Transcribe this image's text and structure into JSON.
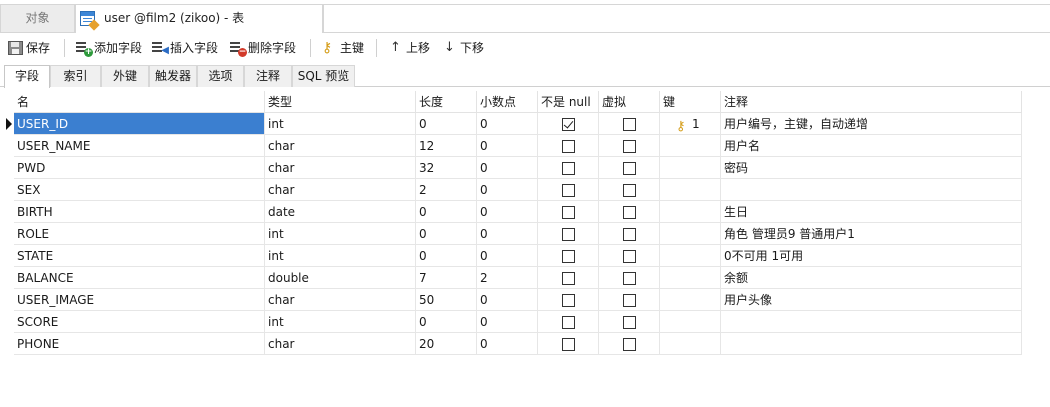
{
  "window_tabs": {
    "objects_label": "对象",
    "active_label": "user @film2 (zikoo) - 表"
  },
  "toolbar": {
    "save": "保存",
    "add_field": "添加字段",
    "insert_field": "插入字段",
    "delete_field": "删除字段",
    "primary_key": "主键",
    "move_up": "上移",
    "move_down": "下移"
  },
  "subtabs": [
    "字段",
    "索引",
    "外键",
    "触发器",
    "选项",
    "注释",
    "SQL 预览"
  ],
  "columns": {
    "name": "名",
    "type": "类型",
    "length": "长度",
    "decimals": "小数点",
    "not_null": "不是 null",
    "virtual": "虚拟",
    "key": "键",
    "comment": "注释"
  },
  "fields": [
    {
      "name": "USER_ID",
      "type": "int",
      "length": "0",
      "decimals": "0",
      "not_null": true,
      "virtual": false,
      "key": "1",
      "comment": "用户编号，主键，自动递增",
      "selected": true
    },
    {
      "name": "USER_NAME",
      "type": "char",
      "length": "12",
      "decimals": "0",
      "not_null": false,
      "virtual": false,
      "key": "",
      "comment": "用户名"
    },
    {
      "name": "PWD",
      "type": "char",
      "length": "32",
      "decimals": "0",
      "not_null": false,
      "virtual": false,
      "key": "",
      "comment": "密码"
    },
    {
      "name": "SEX",
      "type": "char",
      "length": "2",
      "decimals": "0",
      "not_null": false,
      "virtual": false,
      "key": "",
      "comment": ""
    },
    {
      "name": "BIRTH",
      "type": "date",
      "length": "0",
      "decimals": "0",
      "not_null": false,
      "virtual": false,
      "key": "",
      "comment": "生日"
    },
    {
      "name": "ROLE",
      "type": "int",
      "length": "0",
      "decimals": "0",
      "not_null": false,
      "virtual": false,
      "key": "",
      "comment": "角色  管理员9  普通用户1"
    },
    {
      "name": "STATE",
      "type": "int",
      "length": "0",
      "decimals": "0",
      "not_null": false,
      "virtual": false,
      "key": "",
      "comment": "0不可用 1可用"
    },
    {
      "name": "BALANCE",
      "type": "double",
      "length": "7",
      "decimals": "2",
      "not_null": false,
      "virtual": false,
      "key": "",
      "comment": "余额"
    },
    {
      "name": "USER_IMAGE",
      "type": "char",
      "length": "50",
      "decimals": "0",
      "not_null": false,
      "virtual": false,
      "key": "",
      "comment": "用户头像"
    },
    {
      "name": "SCORE",
      "type": "int",
      "length": "0",
      "decimals": "0",
      "not_null": false,
      "virtual": false,
      "key": "",
      "comment": ""
    },
    {
      "name": "PHONE",
      "type": "char",
      "length": "20",
      "decimals": "0",
      "not_null": false,
      "virtual": false,
      "key": "",
      "comment": ""
    }
  ]
}
